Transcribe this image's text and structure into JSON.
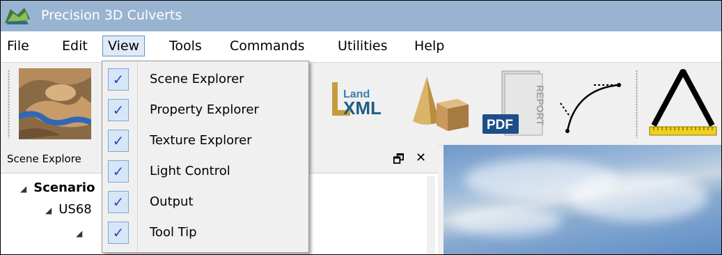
{
  "window": {
    "title": "Precision 3D Culverts"
  },
  "menubar": {
    "items": [
      {
        "label": "File"
      },
      {
        "label": "Edit"
      },
      {
        "label": "View"
      },
      {
        "label": "Tools"
      },
      {
        "label": "Commands"
      },
      {
        "label": "Utilities"
      },
      {
        "label": "Help"
      }
    ],
    "open_item": "View"
  },
  "view_menu": {
    "items": [
      {
        "label": "Scene Explorer",
        "checked": true
      },
      {
        "label": "Property Explorer",
        "checked": true
      },
      {
        "label": "Texture Explorer",
        "checked": true
      },
      {
        "label": "Light Control",
        "checked": true
      },
      {
        "label": "Output",
        "checked": true
      },
      {
        "label": "Tool Tip",
        "checked": true
      }
    ],
    "check_glyph": "✓"
  },
  "toolbar": {
    "landxml_top": "Land",
    "landxml_bottom": "XML",
    "pdf_label": "PDF",
    "report_label": "REPORT"
  },
  "scene_panel": {
    "title": "Scene Explore",
    "restore_glyph": "🗗",
    "close_glyph": "✕",
    "tree": [
      {
        "label": "Scenario",
        "bold": true,
        "arrow": "◢"
      },
      {
        "label": "US68",
        "bold": false,
        "arrow": "◢"
      },
      {
        "label": "",
        "bold": false,
        "arrow": "◢"
      }
    ]
  },
  "colors": {
    "titlebar": "#99b4d1",
    "menu_open_border": "#5f8fc9",
    "check_color": "#1e4fbf"
  }
}
